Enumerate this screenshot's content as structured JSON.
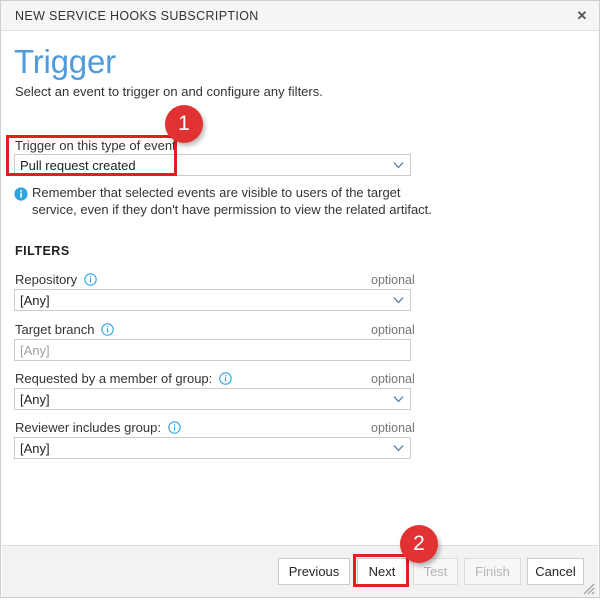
{
  "window": {
    "title": "NEW SERVICE HOOKS SUBSCRIPTION",
    "close_label": "✕",
    "close_icon": "close-icon"
  },
  "page": {
    "heading": "Trigger",
    "subheading": "Select an event to trigger on and configure any filters."
  },
  "trigger": {
    "label": "Trigger on this type of event",
    "value": "Pull request created",
    "chevron_icon": "chevron-down-icon"
  },
  "note": {
    "icon": "info-filled-icon",
    "text": "Remember that selected events are visible to users of the target service, even if they don't have permission to view the related artifact."
  },
  "filters": {
    "heading": "FILTERS",
    "optional_label": "optional",
    "info_icon": "info-outline-icon",
    "fields": [
      {
        "label": "Repository",
        "info": true,
        "optional": "optional",
        "value": "[Any]",
        "is_placeholder": false,
        "control": "dropdown"
      },
      {
        "label": "Target branch",
        "info": true,
        "optional": "optional",
        "value": "[Any]",
        "is_placeholder": true,
        "control": "text"
      },
      {
        "label": "Requested by a member of group:",
        "info": true,
        "optional": "optional",
        "value": "[Any]",
        "is_placeholder": false,
        "control": "dropdown"
      },
      {
        "label": "Reviewer includes group:",
        "info": true,
        "optional": "optional",
        "value": "[Any]",
        "is_placeholder": false,
        "control": "dropdown"
      }
    ]
  },
  "footer": {
    "buttons": [
      {
        "label": "Previous",
        "disabled": false
      },
      {
        "label": "Next",
        "disabled": false
      },
      {
        "label": "Test",
        "disabled": true
      },
      {
        "label": "Finish",
        "disabled": true
      },
      {
        "label": "Cancel",
        "disabled": false
      }
    ],
    "resize_grip_icon": "resize-grip-icon"
  },
  "annotations": {
    "badges": [
      {
        "label": "1"
      },
      {
        "label": "2"
      }
    ],
    "highlight_color": "#e02020",
    "badge_color": "#e03232"
  }
}
